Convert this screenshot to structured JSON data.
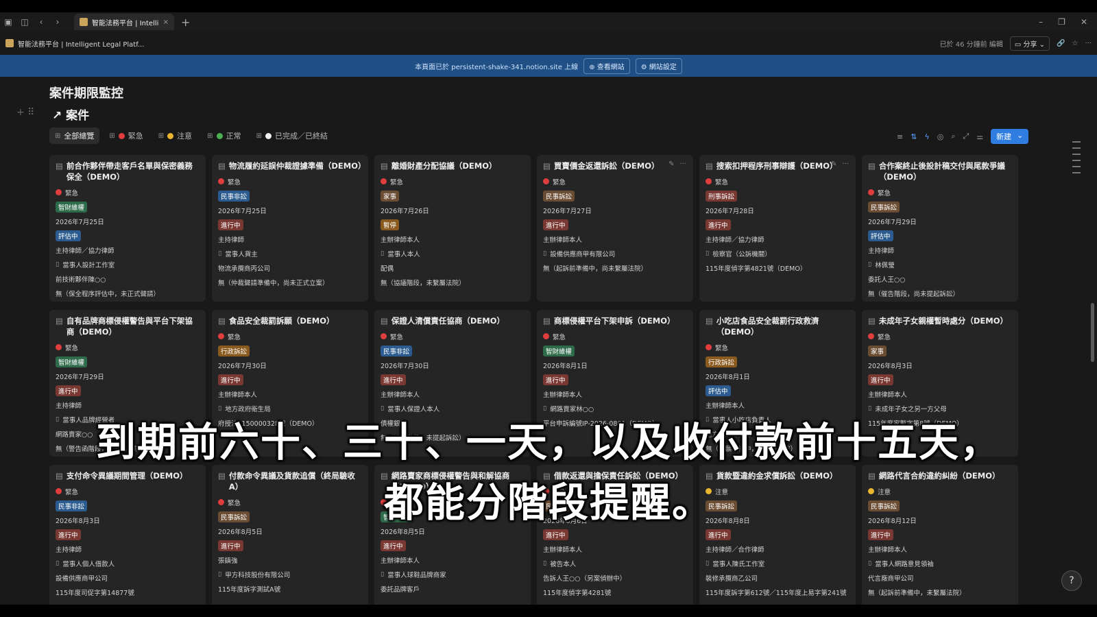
{
  "browser": {
    "tab_title": "智能法務平台 | Intellig...",
    "tab_close": "×",
    "new_tab": "+",
    "page_crumb": "智能法務平台 | Intelligent Legal Platf...",
    "edited": "已於 46 分鐘前 編輯",
    "share": "分享"
  },
  "banner": {
    "text": "本頁面已於 persistent-shake-341.notion.site 上線",
    "view_site": "⊕ 查看網站",
    "site_settings": "⚙ 網站設定"
  },
  "page": {
    "title": "案件期限監控",
    "db_title": "↗ 案件"
  },
  "views": [
    {
      "label": "全部總覽",
      "dot": ""
    },
    {
      "label": "緊急",
      "dot": "#e03e3e"
    },
    {
      "label": "注意",
      "dot": "#e9b530"
    },
    {
      "label": "正常",
      "dot": "#4caf50"
    },
    {
      "label": "已完成／已終結",
      "dot": "#f2f2f2"
    }
  ],
  "toolbar": {
    "new": "新建"
  },
  "colors": {
    "urgent": "#e03e3e",
    "attention": "#e9b530",
    "blue": "#2f7de1"
  },
  "cards": [
    {
      "title": "前合作夥伴帶走客戶名單與保密義務保全（DEMO）",
      "priority": "緊急",
      "type": "智財維權",
      "date": "2026年7月25日",
      "status": "評估中",
      "role": "主持律師／協力律師",
      "party": "當事人設計工作室",
      "opp": "前技術夥伴陳○○",
      "court": "無（保全程序評估中，未正式聲請）"
    },
    {
      "title": "物流履約延誤仲裁證據準備（DEMO）",
      "priority": "緊急",
      "type": "民事非訟",
      "date": "2026年7月25日",
      "status": "進行中",
      "role": "主持律師",
      "party": "當事人貨主",
      "opp": "物流承攬商丙公司",
      "court": "無（仲裁聲請準備中，尚未正式立案）"
    },
    {
      "title": "離婚財產分配協議（DEMO）",
      "priority": "緊急",
      "type": "家事",
      "date": "2026年7月26日",
      "status": "暫停",
      "role": "主辦律師本人",
      "party": "當事人本人",
      "opp": "配偶",
      "court": "無（協議階段，未繫屬法院）"
    },
    {
      "title": "買賣價金返還訴訟（DEMO）",
      "priority": "緊急",
      "type": "民事訴訟",
      "date": "2026年7月27日",
      "status": "進行中",
      "role": "主辦律師本人",
      "party": "設備供應商甲有限公司",
      "opp": "",
      "court": "無（起訴前準備中，尚未繫屬法院）"
    },
    {
      "title": "搜索扣押程序刑事辯護（DEMO）",
      "priority": "緊急",
      "type": "刑事訴訟",
      "date": "2026年7月28日",
      "status": "進行中",
      "role": "主持律師／協力律師",
      "party": "檢察官（公訴機關）",
      "opp": "",
      "court": "115年度偵字第4821號（DEMO）"
    },
    {
      "title": "合作案終止後設計稿交付與尾款爭議（DEMO）",
      "priority": "緊急",
      "type": "民事訴訟",
      "date": "2026年7月29日",
      "status": "評估中",
      "role": "主持律師",
      "party": "林佩瑩",
      "opp": "委託人王○○",
      "court": "無（催告階段，尚未提起訴訟）"
    },
    {
      "title": "自有品牌商標侵權警告與平台下架協商（DEMO）",
      "priority": "緊急",
      "type": "智財維權",
      "date": "2026年7月29日",
      "status": "進行中",
      "role": "主持律師",
      "party": "當事人品牌經營者",
      "opp": "網路賣家○○",
      "court": "無（警告函階段，未繫屬法院）"
    },
    {
      "title": "食品安全裁罰訴願（DEMO）",
      "priority": "緊急",
      "type": "行政訴訟",
      "date": "2026年7月30日",
      "status": "進行中",
      "role": "主辦律師本人",
      "party": "地方政府衛生局",
      "opp": "",
      "court": "府授法1150000328號（DEMO）"
    },
    {
      "title": "保證人清償責任協商（DEMO）",
      "priority": "緊急",
      "type": "民事非訟",
      "date": "2026年7月30日",
      "status": "進行中",
      "role": "主辦律師本人",
      "party": "當事人保證人本人",
      "opp": "債權銀行",
      "court": "無（協商階段，未提起訴訟）"
    },
    {
      "title": "商標侵權平台下架申訴（DEMO）",
      "priority": "緊急",
      "type": "智財維權",
      "date": "2026年8月1日",
      "status": "進行中",
      "role": "主辦律師本人",
      "party": "網路賣家林○○",
      "opp": "",
      "court": "平台申訴編號IP-2026-0801（DEMO）"
    },
    {
      "title": "小吃店食品安全裁罰行政救濟（DEMO）",
      "priority": "緊急",
      "type": "行政訴訟",
      "date": "2026年8月1日",
      "status": "評估中",
      "role": "主辦律師本人",
      "party": "當事人小吃店負責人",
      "opp": "地方政府衛生局",
      "court": "無（訴願準備中，未繫屬法院）"
    },
    {
      "title": "未成年子女親權暫時處分（DEMO）",
      "priority": "緊急",
      "type": "家事",
      "date": "2026年8月3日",
      "status": "進行中",
      "role": "主辦律師本人",
      "party": "未成年子女之另一方父母",
      "opp": "",
      "court": "115年度家暫字第8號（DEMO）"
    },
    {
      "title": "支付命令異議期間管理（DEMO）",
      "priority": "緊急",
      "type": "民事非訟",
      "date": "2026年8月3日",
      "status": "進行中",
      "role": "主持律師",
      "party": "當事人個人借款人",
      "opp": "設備供應商甲公司",
      "court": "115年度司促字第14877號"
    },
    {
      "title": "付款命令異議及貨款追償（終局驗收A）",
      "priority": "緊急",
      "type": "民事訴訟",
      "date": "2026年8月5日",
      "status": "進行中",
      "role": "張鎮強",
      "party": "甲方科技股份有限公司",
      "opp": "115年度訴字測試A號",
      "court": ""
    },
    {
      "title": "網路賣家商標侵權警告與和解協商（DEMO）",
      "priority": "緊急",
      "type": "智財維權",
      "date": "2026年8月5日",
      "status": "進行中",
      "role": "主辦律師本人",
      "party": "當事人球鞋品牌商家",
      "opp": "委託品牌客戶",
      "court": ""
    },
    {
      "title": "借款返還與擔保責任訴訟（DEMO）",
      "priority": "緊急",
      "type": "民事訴訟",
      "date": "2026年8月6日",
      "status": "進行中",
      "role": "主辦律師本人",
      "party": "被告本人",
      "opp": "告訴人王○○（另案偵辦中）",
      "court": "115年度偵字第4281號"
    },
    {
      "title": "貨款暨違約金求償訴訟（DEMO）",
      "priority": "注意",
      "type": "民事訴訟",
      "date": "2026年8月8日",
      "status": "進行中",
      "role": "主持律師／合作律師",
      "party": "當事人陳氏工作室",
      "opp": "裝修承攬商乙公司",
      "court": "115年度訴字第612號／115年度上易字第241號"
    },
    {
      "title": "網路代言合約違約糾紛（DEMO）",
      "priority": "注意",
      "type": "民事訴訟",
      "date": "2026年8月12日",
      "status": "進行中",
      "role": "主辦律師本人",
      "party": "當事人網路意見領袖",
      "opp": "代言廠商甲公司",
      "court": "無（起訴前準備中，未繫屬法院）"
    }
  ],
  "subtitle": {
    "line1": "到期前六十、三十、一天，以及收付款前十五天，",
    "line2": "都能分階段提醒。"
  }
}
